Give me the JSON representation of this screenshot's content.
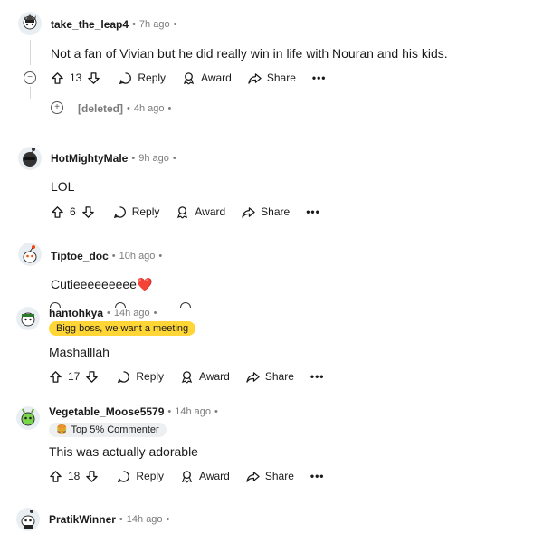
{
  "comments": [
    {
      "username": "take_the_leap4",
      "time": "7h ago",
      "body": "Not a fan of Vivian but he did really win in life with Nouran and his kids.",
      "votes": "13",
      "reply_label": "Reply",
      "award_label": "Award",
      "share_label": "Share",
      "more_label": "•••"
    },
    {
      "username": "HotMightyMale",
      "time": "9h ago",
      "body": "LOL",
      "votes": "6",
      "reply_label": "Reply",
      "award_label": "Award",
      "share_label": "Share",
      "more_label": "•••"
    },
    {
      "username": "Tiptoe_doc",
      "time": "10h ago",
      "body": "Cutieeeeeeeee",
      "emoji": "❤️"
    },
    {
      "username": "hantohkya",
      "time": "14h ago",
      "flair": "Bigg boss, we want a meeting",
      "body": "Mashalllah",
      "votes": "17",
      "reply_label": "Reply",
      "award_label": "Award",
      "share_label": "Share",
      "more_label": "•••"
    },
    {
      "username": "Vegetable_Moose5579",
      "time": "14h ago",
      "flair": "Top 5% Commenter",
      "flair_emoji": "🍔",
      "body": "This was actually adorable",
      "votes": "18",
      "reply_label": "Reply",
      "award_label": "Award",
      "share_label": "Share",
      "more_label": "•••"
    },
    {
      "username": "PratikWinner",
      "time": "14h ago"
    }
  ],
  "deleted_reply": {
    "label": "[deleted]",
    "time": "4h ago"
  },
  "separator": "•",
  "colors": {
    "flair_yellow": "#ffd635",
    "flair_gray": "#edeff1",
    "meta_gray": "#7c7c7c"
  }
}
